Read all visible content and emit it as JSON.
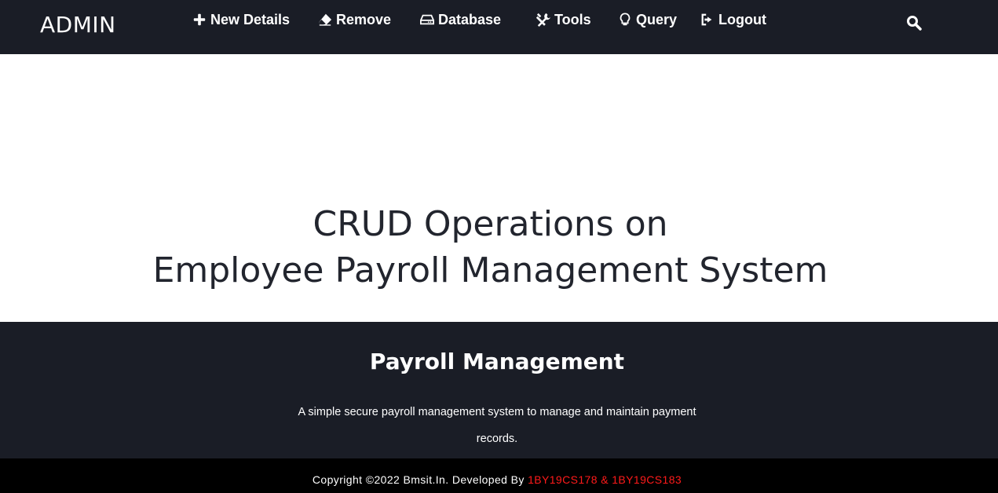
{
  "navbar": {
    "brand": "ADMIN",
    "items": [
      {
        "label": "New Details",
        "icon": "plus-icon"
      },
      {
        "label": "Remove",
        "icon": "eraser-icon"
      },
      {
        "label": "Database",
        "icon": "hard-drive-icon"
      },
      {
        "label": "Tools",
        "icon": "tools-icon"
      },
      {
        "label": "Query",
        "icon": "lightbulb-icon"
      },
      {
        "label": "Logout",
        "icon": "sign-out-icon"
      }
    ],
    "search_icon": "search-icon"
  },
  "hero": {
    "title_line1": "CRUD Operations on",
    "title_line2": "Employee Payroll Management System"
  },
  "footer": {
    "heading": "Payroll Management",
    "description": "A simple secure payroll management system to manage and maintain payment records.",
    "copyright_prefix": "Copyright ©2022 Bmsit.In. Developed By ",
    "developers": "1BY19CS178 & 1BY19CS183"
  },
  "colors": {
    "nav_bg": "#1a1d26",
    "footer_bg": "#1a1d26",
    "copyright_bg": "#000000",
    "accent_red": "#ff1a1a",
    "hero_text": "#22252e"
  }
}
